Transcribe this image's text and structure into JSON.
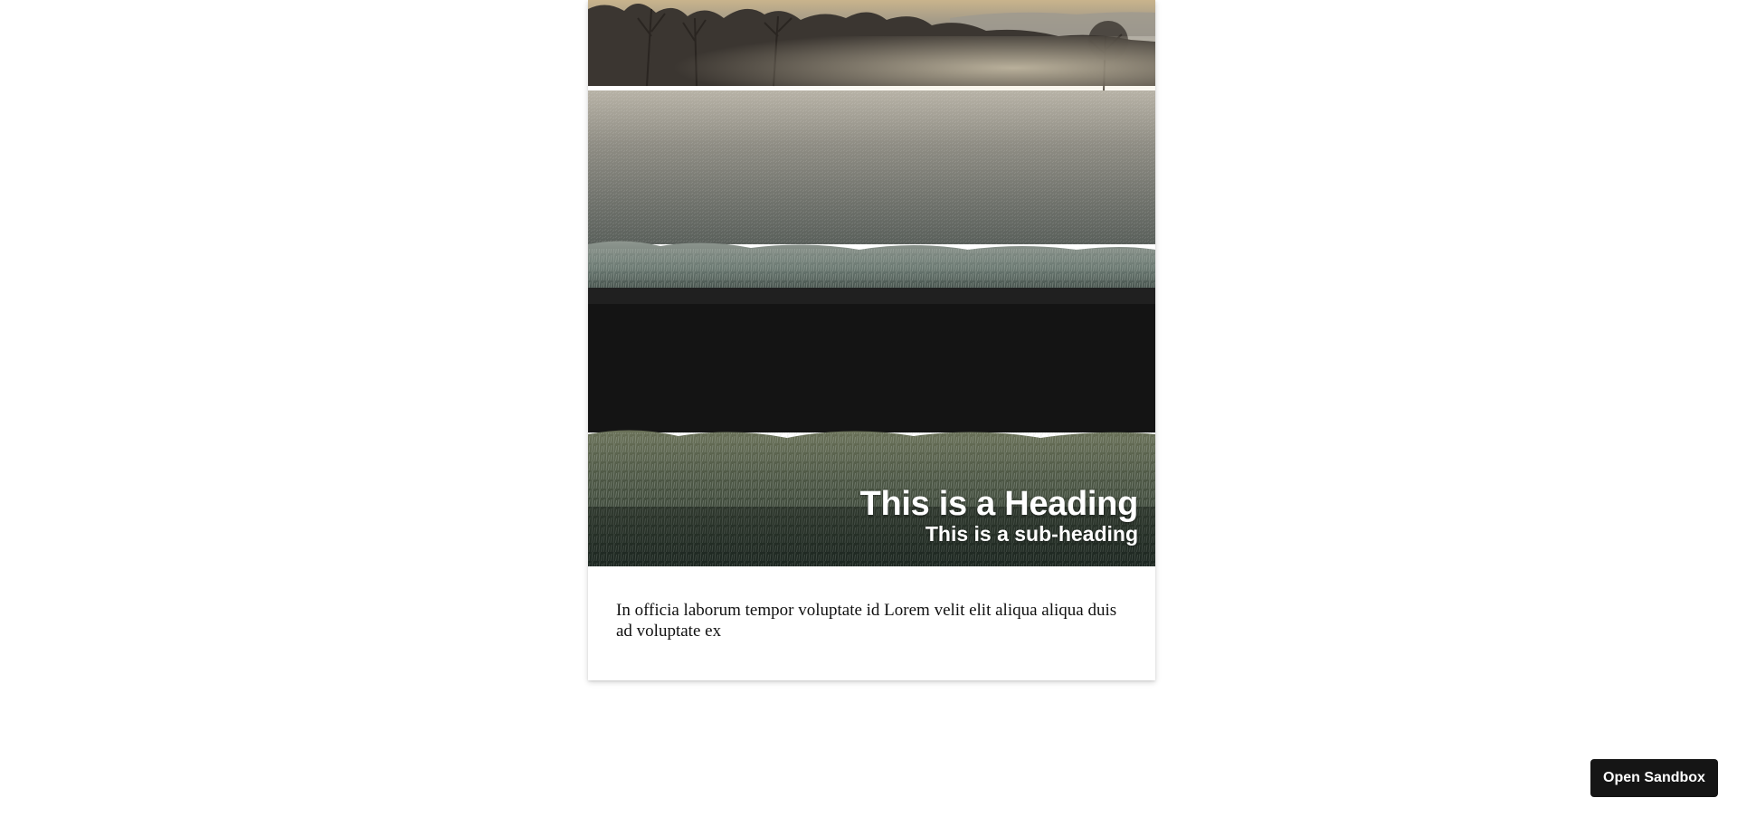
{
  "card": {
    "image_description": "frosted field at sunrise",
    "heading": "This is a Heading",
    "subheading": "This is a sub-heading",
    "body": "In officia laborum tempor voluptate id Lorem velit elit aliqua aliqua duis ad voluptate ex"
  },
  "sandbox_button": {
    "label": "Open Sandbox"
  },
  "colors": {
    "page_background": "#ffffff",
    "card_background": "#ffffff",
    "heading_text": "#ffffff",
    "body_text": "#111111",
    "button_background": "#151515",
    "button_text": "#ffffff"
  }
}
